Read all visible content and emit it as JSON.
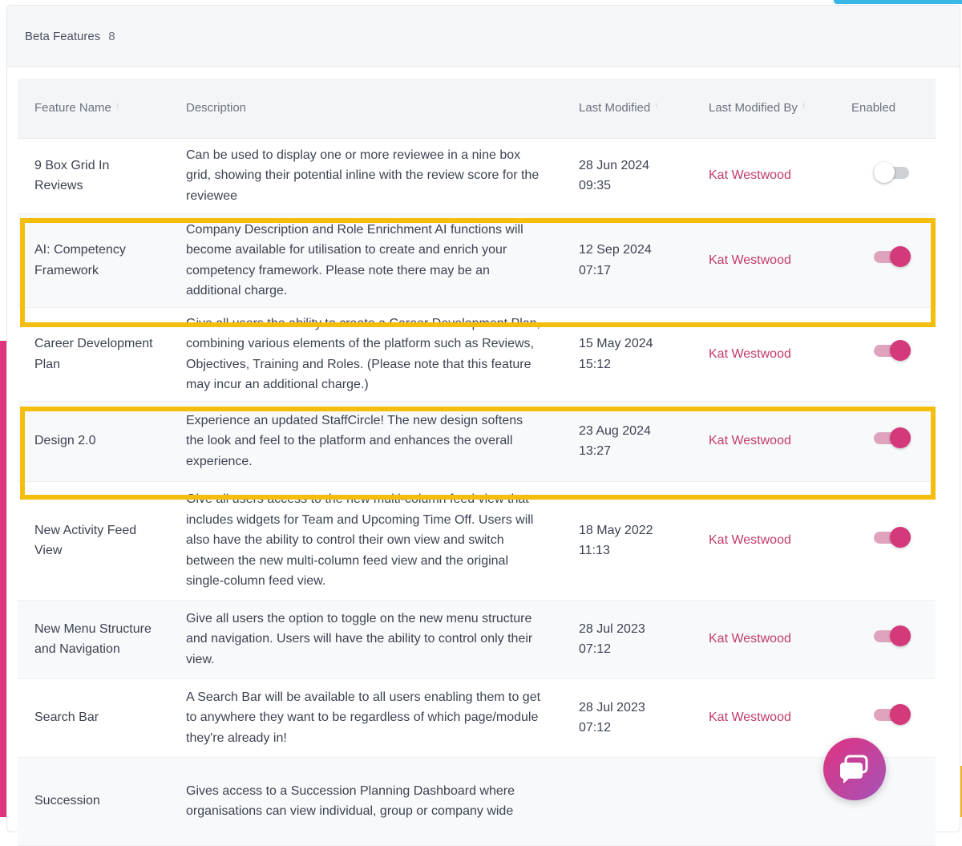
{
  "header": {
    "title": "Beta Features",
    "count": "8"
  },
  "columns": {
    "name": "Feature Name",
    "description": "Description",
    "modified": "Last Modified",
    "modified_by": "Last Modified By",
    "enabled": "Enabled"
  },
  "rows": [
    {
      "name": "9 Box Grid In Reviews",
      "description": "Can be used to display one or more reviewee in a nine box grid, showing their potential inline with the review score for the reviewee",
      "date": "28 Jun 2024",
      "time": "09:35",
      "by": "Kat Westwood",
      "enabled": false
    },
    {
      "name": "AI: Competency Framework",
      "description": "Company Description and Role Enrichment AI functions will become available for utilisation to create and enrich your competency framework. Please note there may be an additional charge.",
      "date": "12 Sep 2024",
      "time": "07:17",
      "by": "Kat Westwood",
      "enabled": true
    },
    {
      "name": "Career Development Plan",
      "description": "Give all users the ability to create a Career Development Plan, combining various elements of the platform such as Reviews, Objectives, Training and Roles. (Please note that this feature may incur an additional charge.)",
      "date": "15 May 2024",
      "time": "15:12",
      "by": "Kat Westwood",
      "enabled": true
    },
    {
      "name": "Design 2.0",
      "description": "Experience an updated StaffCircle! The new design softens the look and feel to the platform and enhances the overall experience.",
      "date": "23 Aug 2024",
      "time": "13:27",
      "by": "Kat Westwood",
      "enabled": true
    },
    {
      "name": "New Activity Feed View",
      "description": "Give all users access to the new multi-column feed view that includes widgets for Team and Upcoming Time Off. Users will also have the ability to control their own view and switch between the new multi-column feed view and the original single-column feed view.",
      "date": "18 May 2022",
      "time": "11:13",
      "by": "Kat Westwood",
      "enabled": true
    },
    {
      "name": "New Menu Structure and Navigation",
      "description": "Give all users the option to toggle on the new menu structure and navigation. Users will have the ability to control only their view.",
      "date": "28 Jul 2023",
      "time": "07:12",
      "by": "Kat Westwood",
      "enabled": true
    },
    {
      "name": "Search Bar",
      "description": "A Search Bar will be available to all users enabling them to get to anywhere they want to be regardless of which page/module they're already in!",
      "date": "28 Jul 2023",
      "time": "07:12",
      "by": "Kat Westwood",
      "enabled": true
    },
    {
      "name": "Succession",
      "description": "Gives access to a Succession Planning Dashboard where organisations can view individual, group or company wide",
      "date": "",
      "time": "",
      "by": "",
      "enabled": null
    }
  ],
  "colors": {
    "accent": "#d43a7b",
    "link": "#c23a6c",
    "highlight": "#f5bd0e"
  },
  "icons": {
    "chat": "chat-bubble-icon",
    "sort": "sort-arrow-icon"
  }
}
